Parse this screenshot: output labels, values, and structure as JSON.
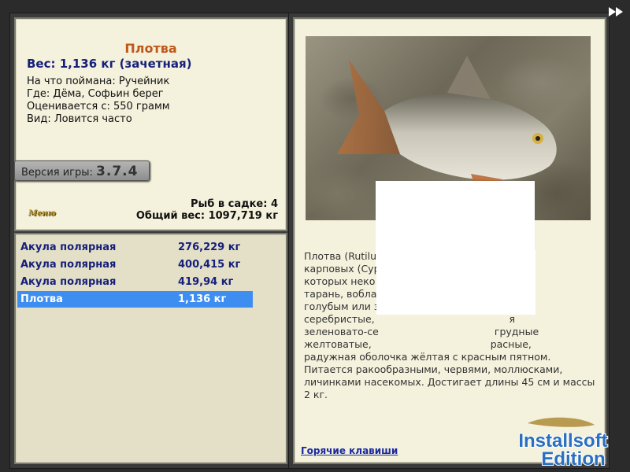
{
  "fish": {
    "name": "Плотва",
    "weight_line": "Вес: 1,136 кг (зачетная)",
    "details": [
      "На что поймана: Ручейник",
      "Где: Дёма, Софьин берег",
      "Оценивается с: 550 грамм",
      "Вид: Ловится часто"
    ]
  },
  "version": {
    "label": "Версия игры:",
    "number": "3.7.4"
  },
  "menu_link": "Меню",
  "stats": {
    "count_line": "Рыб в садке: 4",
    "total_line": "Общий вес: 1097,719 кг"
  },
  "catch_list": [
    {
      "name": "Акула полярная",
      "weight": "276,229 кг",
      "selected": false
    },
    {
      "name": "Акула полярная",
      "weight": "400,415 кг",
      "selected": false
    },
    {
      "name": "Акула полярная",
      "weight": "419,94 кг",
      "selected": false
    },
    {
      "name": "Плотва",
      "weight": "1,136 кг",
      "selected": true
    }
  ],
  "description": {
    "lines": [
      "Плотва (Rutilu                                            а",
      "карповых (Cyp                                     ов, из",
      "которых неко                                  вания:",
      "тарань, вобла                                  атая, с",
      "голубым или з                                        о",
      "серебристые,                                           я",
      "зеленовато-се                                     грудные",
      "желтоватые,                                      расные,",
      "радужная оболочка жёлтая с красным пятном.",
      "Питается ракообразными, червями, моллюсками,",
      "личинками насекомых. Достигает длины 45 см и массы",
      "2 кг."
    ]
  },
  "hotkeys_link": "Горячие клавиши",
  "watermark": {
    "line1": "Installsoft",
    "line2": "Edition"
  },
  "icons": {
    "fast_forward": "fast-forward-icon"
  },
  "colors": {
    "title": "#c0581a",
    "weight": "#16207a",
    "selected_row": "#3e8ef2",
    "panel_bg": "#f4f1dc",
    "link": "#1a2aa0"
  }
}
